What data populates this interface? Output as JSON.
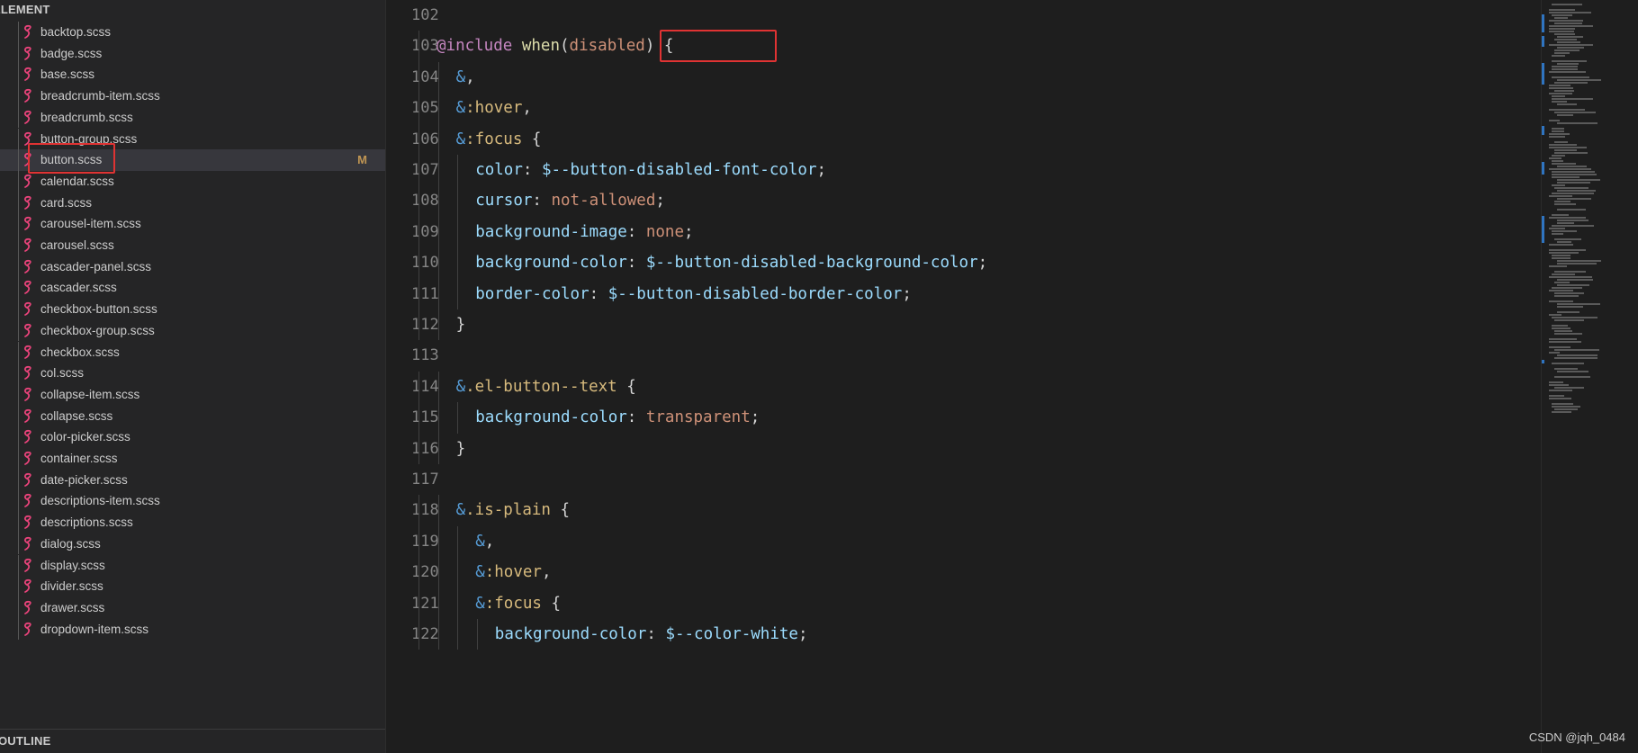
{
  "sidebar": {
    "section_title": "ELEMENT",
    "outline_title": "OUTLINE",
    "files": [
      {
        "label": "backtop.scss"
      },
      {
        "label": "badge.scss"
      },
      {
        "label": "base.scss"
      },
      {
        "label": "breadcrumb-item.scss"
      },
      {
        "label": "breadcrumb.scss"
      },
      {
        "label": "button-group.scss"
      },
      {
        "label": "button.scss",
        "badge": "M",
        "selected": true
      },
      {
        "label": "calendar.scss"
      },
      {
        "label": "card.scss"
      },
      {
        "label": "carousel-item.scss"
      },
      {
        "label": "carousel.scss"
      },
      {
        "label": "cascader-panel.scss"
      },
      {
        "label": "cascader.scss"
      },
      {
        "label": "checkbox-button.scss"
      },
      {
        "label": "checkbox-group.scss"
      },
      {
        "label": "checkbox.scss"
      },
      {
        "label": "col.scss"
      },
      {
        "label": "collapse-item.scss"
      },
      {
        "label": "collapse.scss"
      },
      {
        "label": "color-picker.scss"
      },
      {
        "label": "container.scss"
      },
      {
        "label": "date-picker.scss"
      },
      {
        "label": "descriptions-item.scss"
      },
      {
        "label": "descriptions.scss"
      },
      {
        "label": "dialog.scss"
      },
      {
        "label": "display.scss"
      },
      {
        "label": "divider.scss"
      },
      {
        "label": "drawer.scss"
      },
      {
        "label": "dropdown-item.scss"
      }
    ]
  },
  "editor": {
    "lines": [
      {
        "n": "102",
        "indent": 0,
        "tokens": []
      },
      {
        "n": "103",
        "indent": 1,
        "tokens": [
          [
            "at",
            "@include"
          ],
          [
            "punc",
            " "
          ],
          [
            "fn",
            "when"
          ],
          [
            "punc",
            "("
          ],
          [
            "str",
            "disabled"
          ],
          [
            "punc",
            ") {"
          ]
        ]
      },
      {
        "n": "104",
        "indent": 2,
        "tokens": [
          [
            "amp",
            "&"
          ],
          [
            "punc",
            ","
          ]
        ]
      },
      {
        "n": "105",
        "indent": 2,
        "tokens": [
          [
            "amp",
            "&"
          ],
          [
            "sel",
            ":hover"
          ],
          [
            "punc",
            ","
          ]
        ]
      },
      {
        "n": "106",
        "indent": 2,
        "tokens": [
          [
            "amp",
            "&"
          ],
          [
            "sel",
            ":focus"
          ],
          [
            "punc",
            " {"
          ]
        ]
      },
      {
        "n": "107",
        "indent": 3,
        "tokens": [
          [
            "prop",
            "color"
          ],
          [
            "punc",
            ": "
          ],
          [
            "var",
            "$--button-disabled-font-color"
          ],
          [
            "punc",
            ";"
          ]
        ]
      },
      {
        "n": "108",
        "indent": 3,
        "tokens": [
          [
            "prop",
            "cursor"
          ],
          [
            "punc",
            ": "
          ],
          [
            "str",
            "not-allowed"
          ],
          [
            "punc",
            ";"
          ]
        ]
      },
      {
        "n": "109",
        "indent": 3,
        "tokens": [
          [
            "prop",
            "background-image"
          ],
          [
            "punc",
            ": "
          ],
          [
            "str",
            "none"
          ],
          [
            "punc",
            ";"
          ]
        ]
      },
      {
        "n": "110",
        "indent": 3,
        "tokens": [
          [
            "prop",
            "background-color"
          ],
          [
            "punc",
            ": "
          ],
          [
            "var",
            "$--button-disabled-background-color"
          ],
          [
            "punc",
            ";"
          ]
        ]
      },
      {
        "n": "111",
        "indent": 3,
        "tokens": [
          [
            "prop",
            "border-color"
          ],
          [
            "punc",
            ": "
          ],
          [
            "var",
            "$--button-disabled-border-color"
          ],
          [
            "punc",
            ";"
          ]
        ]
      },
      {
        "n": "112",
        "indent": 2,
        "tokens": [
          [
            "punc",
            "}"
          ]
        ]
      },
      {
        "n": "113",
        "indent": 0,
        "tokens": []
      },
      {
        "n": "114",
        "indent": 2,
        "tokens": [
          [
            "amp",
            "&"
          ],
          [
            "sel",
            ".el-button--text"
          ],
          [
            "punc",
            " {"
          ]
        ]
      },
      {
        "n": "115",
        "indent": 3,
        "tokens": [
          [
            "prop",
            "background-color"
          ],
          [
            "punc",
            ": "
          ],
          [
            "str",
            "transparent"
          ],
          [
            "punc",
            ";"
          ]
        ]
      },
      {
        "n": "116",
        "indent": 2,
        "tokens": [
          [
            "punc",
            "}"
          ]
        ]
      },
      {
        "n": "117",
        "indent": 0,
        "tokens": []
      },
      {
        "n": "118",
        "indent": 2,
        "tokens": [
          [
            "amp",
            "&"
          ],
          [
            "sel",
            ".is-plain"
          ],
          [
            "punc",
            " {"
          ]
        ]
      },
      {
        "n": "119",
        "indent": 3,
        "tokens": [
          [
            "amp",
            "&"
          ],
          [
            "punc",
            ","
          ]
        ]
      },
      {
        "n": "120",
        "indent": 3,
        "tokens": [
          [
            "amp",
            "&"
          ],
          [
            "sel",
            ":hover"
          ],
          [
            "punc",
            ","
          ]
        ]
      },
      {
        "n": "121",
        "indent": 3,
        "tokens": [
          [
            "amp",
            "&"
          ],
          [
            "sel",
            ":focus"
          ],
          [
            "punc",
            " {"
          ]
        ]
      },
      {
        "n": "122",
        "indent": 4,
        "tokens": [
          [
            "prop",
            "background-color"
          ],
          [
            "punc",
            ": "
          ],
          [
            "var",
            "$--color-white"
          ],
          [
            "punc",
            ";"
          ]
        ]
      }
    ]
  },
  "watermark": "CSDN @jqh_0484",
  "colors": {
    "highlight_box": "#e03333",
    "modified_badge": "#c09553",
    "scss_icon": "#e8437a"
  }
}
